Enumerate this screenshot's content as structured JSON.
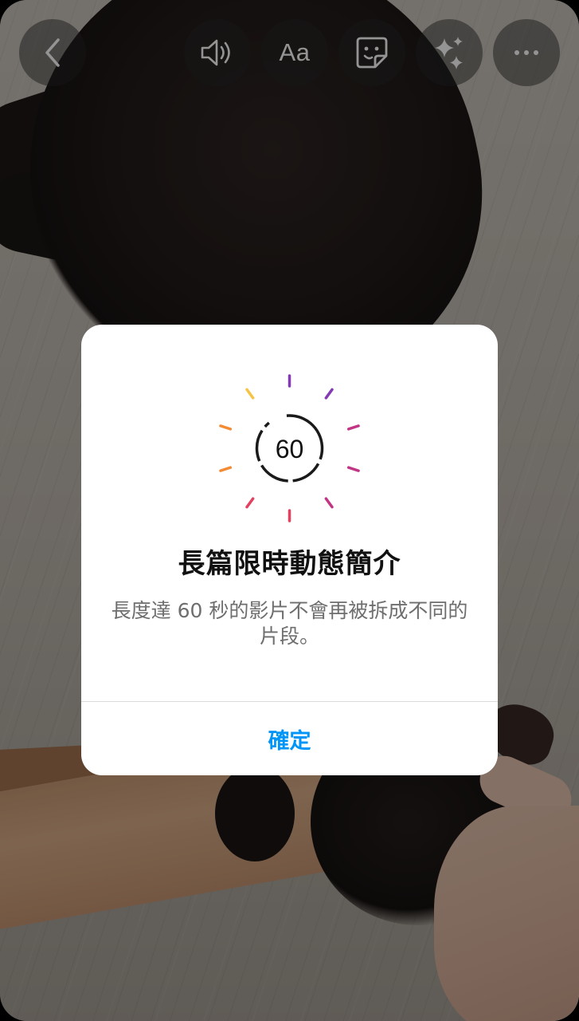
{
  "toolbar": {
    "back": "back-icon",
    "sound": "speaker-icon",
    "text_tool_label": "Aa",
    "sticker": "sticker-icon",
    "effects": "sparkles-icon",
    "more": "more-icon"
  },
  "dialog": {
    "badge_value": "60",
    "title": "長篇限時動態簡介",
    "body": "長度達 60 秒的影片不會再被拆成不同的片段。",
    "confirm_label": "確定"
  },
  "colors": {
    "confirm_blue": "#0095f6",
    "ray_gradient": [
      "#f6c344",
      "#f28b33",
      "#e4405f",
      "#c13584",
      "#833ab4"
    ]
  }
}
